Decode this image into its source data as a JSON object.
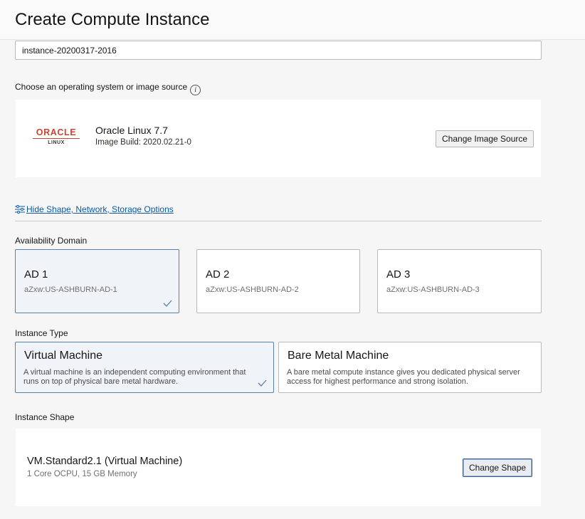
{
  "header": {
    "title": "Create Compute Instance"
  },
  "name_field": {
    "value": "instance-20200317-2016"
  },
  "image_section": {
    "label": "Choose an operating system or image source",
    "info_glyph": "i",
    "logo": {
      "word": "ORACLE",
      "sub": "LINUX"
    },
    "image_name": "Oracle Linux 7.7",
    "image_build": "Image Build: 2020.02.21-0",
    "change_button": "Change Image Source"
  },
  "toggle_link": "Hide Shape, Network, Storage Options",
  "availability_domain": {
    "label": "Availability Domain",
    "options": [
      {
        "title": "AD 1",
        "sub": "aZxw:US-ASHBURN-AD-1",
        "selected": true
      },
      {
        "title": "AD 2",
        "sub": "aZxw:US-ASHBURN-AD-2",
        "selected": false
      },
      {
        "title": "AD 3",
        "sub": "aZxw:US-ASHBURN-AD-3",
        "selected": false
      }
    ]
  },
  "instance_type": {
    "label": "Instance Type",
    "options": [
      {
        "title": "Virtual Machine",
        "desc": "A virtual machine is an independent computing environment that runs on top of physical bare metal hardware.",
        "selected": true
      },
      {
        "title": "Bare Metal Machine",
        "desc": "A bare metal compute instance gives you dedicated physical server access for highest performance and strong isolation.",
        "selected": false
      }
    ]
  },
  "instance_shape": {
    "label": "Instance Shape",
    "shape_name": "VM.Standard2.1 (Virtual Machine)",
    "shape_sub": "1 Core OCPU, 15 GB Memory",
    "change_button": "Change Shape"
  },
  "colors": {
    "link": "#0a5ba8",
    "selected_border": "#5a81ad",
    "oracle_red": "#c74634"
  }
}
